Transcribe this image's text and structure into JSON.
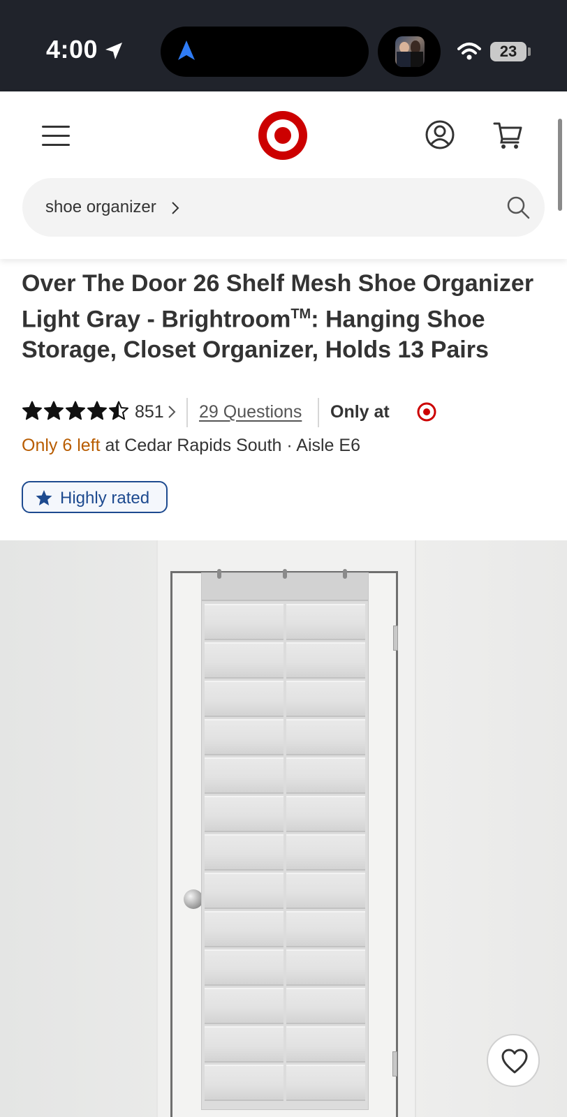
{
  "status_bar": {
    "time": "4:00",
    "battery": "23"
  },
  "header": {
    "search": {
      "query": "shoe organizer"
    }
  },
  "product": {
    "title": "Over The Door 26 Shelf Mesh Shoe Organizer Light Gray - Brightroom",
    "title_mark": "TM",
    "title_rest": ": Hanging Shoe Storage, Closet Organizer, Holds 13 Pairs",
    "rating": 4.5,
    "review_count": "851",
    "questions_label": "29 Questions",
    "only_at_label": "Only at",
    "stock": {
      "quantity_text": "Only 6 left",
      "location_text": " at Cedar Rapids South · Aisle E6"
    },
    "badge_label": "Highly rated"
  },
  "colors": {
    "brand_red": "#cc0000",
    "stock_orange": "#b85c00",
    "badge_blue": "#1d4a8f"
  },
  "icons": {
    "menu": "hamburger-icon",
    "logo": "target-logo",
    "account": "account-icon",
    "cart": "cart-icon",
    "search": "search-icon",
    "favorite": "heart-icon"
  }
}
